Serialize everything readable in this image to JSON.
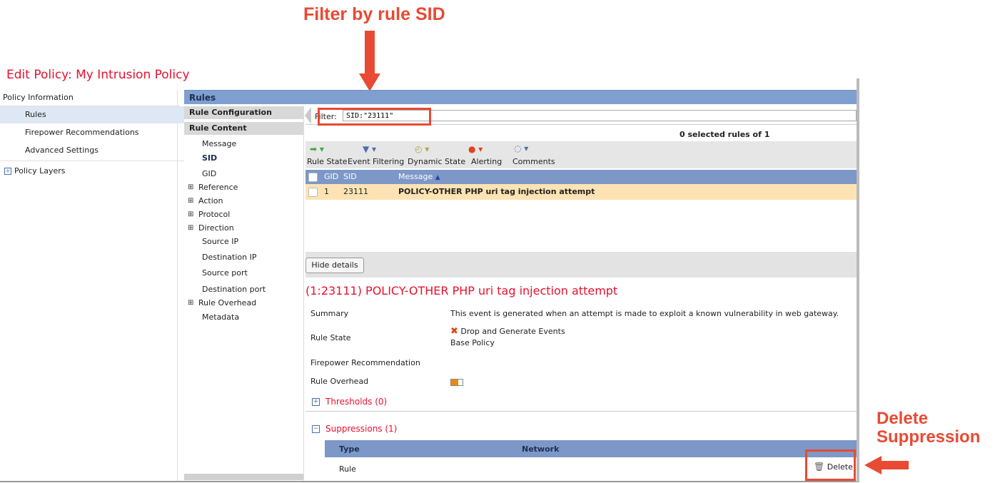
{
  "annotations": {
    "filter_callout": "Filter by rule SID",
    "delete_callout_line1": "Delete",
    "delete_callout_line2": "Suppression"
  },
  "colors": {
    "annotation": "#e84a33",
    "title_red": "#e8112d",
    "header_blue": "#7d98c7",
    "selected_row": "#fde3b4"
  },
  "page_title": "Edit Policy: My Intrusion Policy",
  "left_nav": {
    "header": "Policy Information",
    "items": [
      {
        "label": "Rules",
        "selected": true
      },
      {
        "label": "Firepower Recommendations",
        "selected": false
      },
      {
        "label": "Advanced Settings",
        "selected": false
      }
    ],
    "policy_layers": "Policy Layers",
    "expand_icon": "plus-box-icon"
  },
  "rules_bar": {
    "title": "Rules"
  },
  "middle": {
    "rule_configuration": "Rule Configuration",
    "rule_content": "Rule Content",
    "items": [
      {
        "label": "Message",
        "expandable": false,
        "bold": false
      },
      {
        "label": "SID",
        "expandable": false,
        "bold": true
      },
      {
        "label": "GID",
        "expandable": false,
        "bold": false
      },
      {
        "label": "Reference",
        "expandable": true,
        "bold": false
      },
      {
        "label": "Action",
        "expandable": true,
        "bold": false
      },
      {
        "label": "Protocol",
        "expandable": true,
        "bold": false
      },
      {
        "label": "Direction",
        "expandable": true,
        "bold": false
      },
      {
        "label": "Source IP",
        "expandable": false,
        "bold": false
      },
      {
        "label": "Destination IP",
        "expandable": false,
        "bold": false
      },
      {
        "label": "Source port",
        "expandable": false,
        "bold": false
      },
      {
        "label": "Destination port",
        "expandable": false,
        "bold": false
      },
      {
        "label": "Rule Overhead",
        "expandable": true,
        "bold": false
      },
      {
        "label": "Metadata",
        "expandable": false,
        "bold": false
      }
    ]
  },
  "filter": {
    "label": "Filter:",
    "value": "SID:\"23111\""
  },
  "selection_count": "0 selected rules of 1",
  "toolbar": {
    "buttons": [
      {
        "label": "Rule State",
        "icon": "green-arrow-icon"
      },
      {
        "label": "Event Filtering",
        "icon": "funnel-icon"
      },
      {
        "label": "Dynamic State",
        "icon": "clock-icon"
      },
      {
        "label": "Alerting",
        "icon": "alert-icon"
      },
      {
        "label": "Comments",
        "icon": "comment-icon"
      }
    ]
  },
  "table": {
    "columns": [
      "GID",
      "SID",
      "Message"
    ],
    "sort_indicator": "▲",
    "rows": [
      {
        "gid": "1",
        "sid": "23111",
        "message": "POLICY-OTHER PHP uri tag injection attempt"
      }
    ]
  },
  "details": {
    "hide_button": "Hide details",
    "title": "(1:23111) POLICY-OTHER PHP uri tag injection attempt",
    "summary_label": "Summary",
    "summary_value": "This event is generated when an attempt is made to exploit a known vulnerability in web gateway.",
    "rule_state_label": "Rule State",
    "rule_state_value": "Drop and Generate Events",
    "rule_state_source": "Base Policy",
    "firepower_label": "Firepower Recommendation",
    "overhead_label": "Rule Overhead",
    "thresholds": "Thresholds (0)",
    "suppressions": "Suppressions (1)",
    "sup_columns": {
      "type": "Type",
      "network": "Network"
    },
    "sup_rows": [
      {
        "type": "Rule",
        "network": ""
      }
    ],
    "delete_label": "Delete"
  }
}
